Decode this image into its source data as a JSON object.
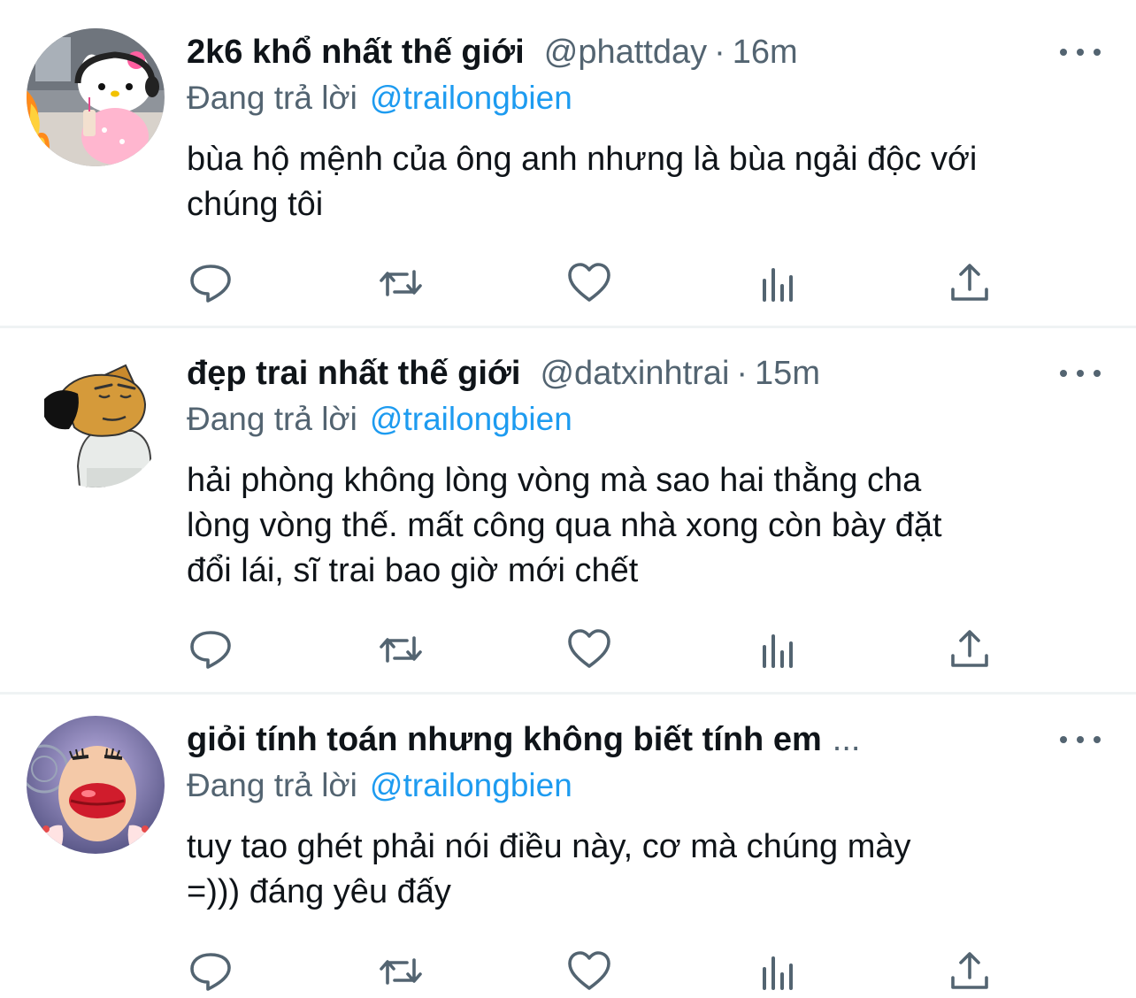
{
  "tweets": [
    {
      "name": "2k6 khổ nhất thế giới",
      "handle": "@phattday",
      "separator": "·",
      "time": "16m",
      "replying_prefix": "Đang trả lời",
      "replying_to": "@trailongbien",
      "lines": [
        "bùa hộ mệnh của ông anh nhưng là bùa ngải độc với",
        "chúng tôi"
      ],
      "avatar_icon": "hello-kitty-avatar"
    },
    {
      "name": "đẹp trai nhất thế giới",
      "handle": "@datxinhtrai",
      "separator": "·",
      "time": "15m",
      "replying_prefix": "Đang trả lời",
      "replying_to": "@trailongbien",
      "lines": [
        "hải phòng không lòng vòng mà sao hai thằng cha",
        "lòng vòng thế. mất công qua nhà xong còn bày đặt",
        "đổi lái, sĩ trai bao giờ mới chết"
      ],
      "avatar_icon": "cartoon-dog-avatar"
    },
    {
      "name": "giỏi tính toán nhưng không biết tính em",
      "name_overflow": "...",
      "replying_prefix": "Đang trả lời",
      "replying_to": "@trailongbien",
      "lines": [
        "tuy tao ghét phải nói điều này, cơ mà chúng mày",
        "=))) đáng yêu đấy"
      ],
      "avatar_icon": "meme-face-avatar"
    }
  ],
  "actions": [
    "reply-icon",
    "retweet-icon",
    "like-icon",
    "analytics-icon",
    "share-icon"
  ],
  "colors": {
    "text": "#0f1419",
    "secondary": "#536471",
    "mention": "#1d9bf0",
    "divider": "#eff3f4",
    "icon": "#536471"
  }
}
